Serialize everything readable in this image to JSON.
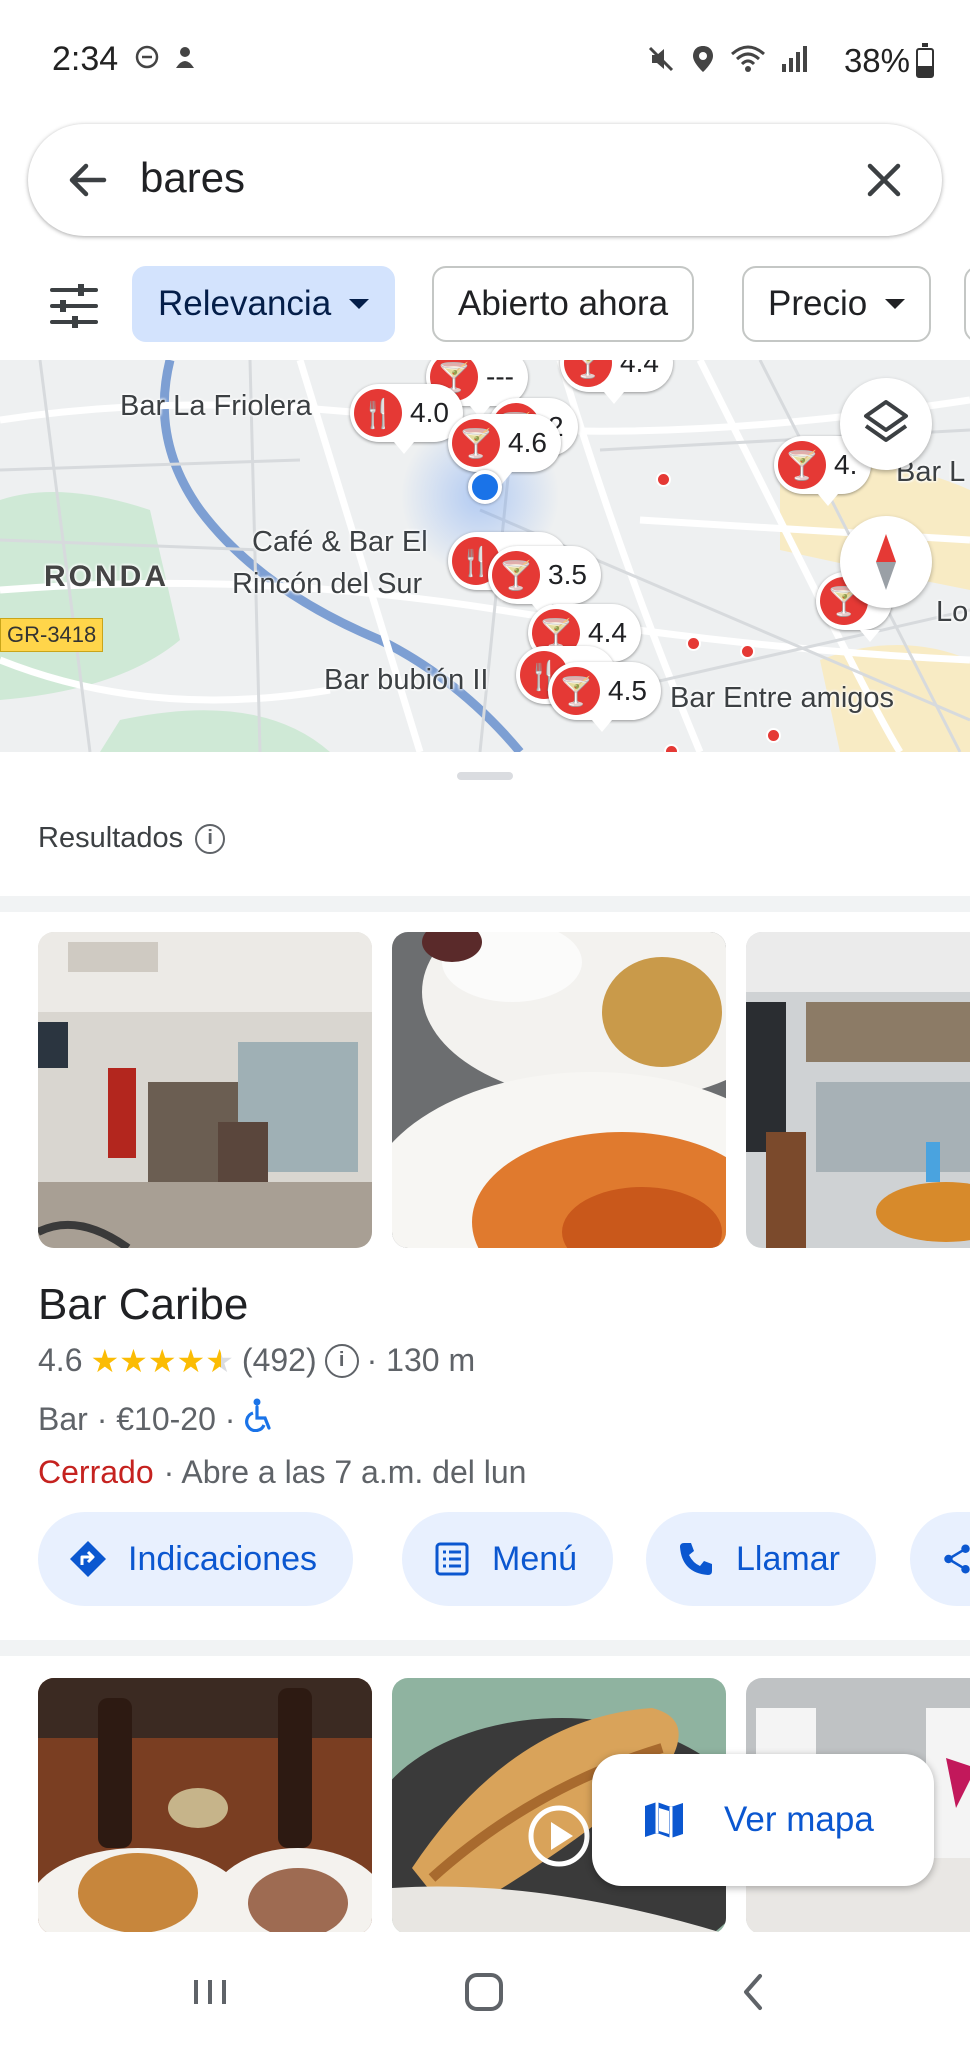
{
  "status_bar": {
    "time": "2:34",
    "battery": "38%",
    "battery_level": 0.38
  },
  "search": {
    "query": "bares",
    "back_icon": "arrow-left-icon",
    "clear_icon": "close-icon"
  },
  "filters": {
    "chips": [
      {
        "label": "Relevancia",
        "dropdown": true,
        "active": true
      },
      {
        "label": "Abierto ahora",
        "dropdown": false,
        "active": false
      },
      {
        "label": "Precio",
        "dropdown": true,
        "active": false
      }
    ]
  },
  "map": {
    "labels": {
      "bar_la_friolera": "Bar La Friolera",
      "ronda": "RONDA",
      "cafe_bar_el": "Café & Bar El",
      "rincon_del_sur": "Rincón del Sur",
      "bar_bubion": "Bar bubión II",
      "bar_entre_amigos": "Bar Entre amigos",
      "bar_l": "Bar L",
      "lo": "Lo",
      "road": "GR-3418"
    },
    "pins": {
      "p1": "4.0",
      "p2": "4.6",
      "p3": "3.5",
      "p4": "4.4",
      "p5": "4.5",
      "p6": "---",
      "p7": "4.",
      "p8": "2",
      "p9": "4.4"
    }
  },
  "sheet": {
    "results_label": "Resultados"
  },
  "place": {
    "name": "Bar Caribe",
    "rating": "4.6",
    "rating_value": 4.6,
    "reviews": "(492)",
    "distance": "· 130 m",
    "category_price": "Bar · €10-20 ·",
    "status": "Cerrado",
    "hours": "· Abre a las 7 a.m. del lun"
  },
  "actions": [
    {
      "label": "Indicaciones",
      "icon": "directions-icon"
    },
    {
      "label": "Menú",
      "icon": "menu-list-icon"
    },
    {
      "label": "Llamar",
      "icon": "phone-icon"
    }
  ],
  "fab": {
    "ver_mapa": "Ver mapa"
  },
  "colors": {
    "accent": "#0b57d0",
    "chip_active": "#d3e3fd",
    "pin_red": "#e53935",
    "closed": "#c5221f",
    "star": "#fbbc04"
  }
}
